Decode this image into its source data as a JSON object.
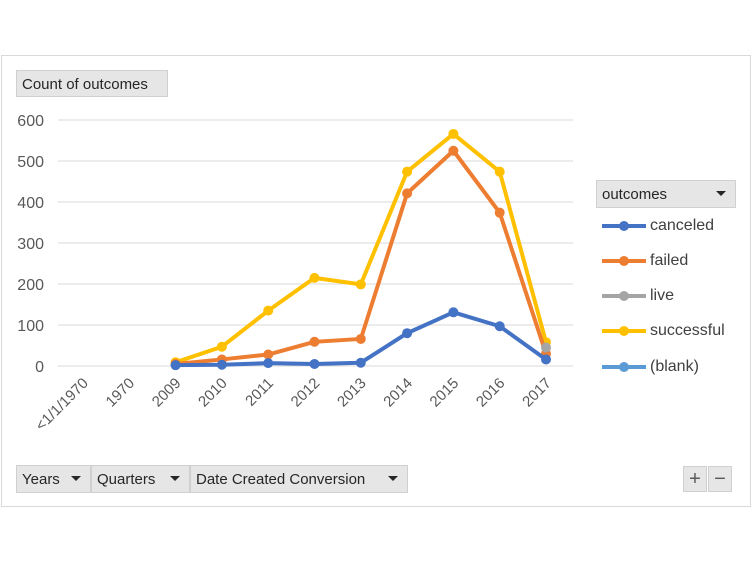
{
  "header": {
    "count_label": "Count of outcomes"
  },
  "legend": {
    "title": "outcomes",
    "items": [
      {
        "label": "canceled",
        "color": "#4472c4"
      },
      {
        "label": "failed",
        "color": "#ed7d31"
      },
      {
        "label": "live",
        "color": "#a5a5a5"
      },
      {
        "label": "successful",
        "color": "#ffc000"
      },
      {
        "label": "(blank)",
        "color": "#5b9bd5"
      }
    ]
  },
  "filters": {
    "years": "Years",
    "quarters": "Quarters",
    "date_created": "Date Created Conversion"
  },
  "zoom": {
    "plus": "+",
    "minus": "−"
  },
  "chart_data": {
    "type": "line",
    "categories": [
      "<1/1/1970",
      "1970",
      "2009",
      "2010",
      "2011",
      "2012",
      "2013",
      "2014",
      "2015",
      "2016",
      "2017"
    ],
    "ylim": [
      0,
      600
    ],
    "yticks": [
      0,
      100,
      200,
      300,
      400,
      500,
      600
    ],
    "grid": true,
    "legend_position": "right",
    "series": [
      {
        "name": "canceled",
        "color": "#4472c4",
        "values": [
          null,
          null,
          2,
          3,
          7,
          5,
          8,
          80,
          131,
          97,
          16
        ]
      },
      {
        "name": "failed",
        "color": "#ed7d31",
        "values": [
          null,
          null,
          5,
          16,
          28,
          59,
          66,
          421,
          525,
          374,
          30
        ]
      },
      {
        "name": "live",
        "color": "#a5a5a5",
        "values": [
          null,
          null,
          null,
          null,
          null,
          null,
          null,
          null,
          null,
          null,
          45
        ]
      },
      {
        "name": "successful",
        "color": "#ffc000",
        "values": [
          null,
          null,
          9,
          47,
          135,
          215,
          199,
          474,
          566,
          474,
          58
        ]
      }
    ]
  }
}
